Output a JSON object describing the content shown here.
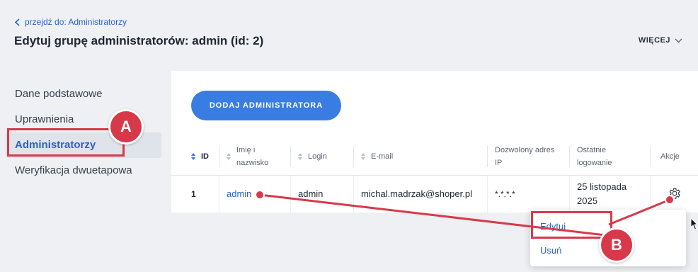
{
  "header": {
    "back_link": "przejdź do: Administratorzy",
    "title": "Edytuj grupę administratorów: admin (id: 2)",
    "more_label": "WIĘCEJ"
  },
  "sidebar": {
    "items": [
      {
        "label": "Dane podstawowe"
      },
      {
        "label": "Uprawnienia"
      },
      {
        "label": "Administratorzy"
      },
      {
        "label": "Weryfikacja dwuetapowa"
      }
    ]
  },
  "main": {
    "add_button": "DODAJ ADMINISTRATORA",
    "columns": {
      "id": "ID",
      "name": "Imię i nazwisko",
      "login": "Login",
      "email": "E-mail",
      "ip": "Dozwolony adres IP",
      "last_login": "Ostatnie logowanie",
      "actions": "Akcje"
    },
    "rows": [
      {
        "id": "1",
        "name": "admin",
        "login": "admin",
        "email": "michal.madrzak@shoper.pl",
        "ip": "*.*.*.*",
        "last_login": "25 listopada 2025"
      }
    ]
  },
  "action_menu": {
    "edit": "Edytuj",
    "delete": "Usuń"
  },
  "annotations": {
    "a": "A",
    "b": "B"
  },
  "colors": {
    "accent": "#3a7de2",
    "link": "#2d62c8",
    "callout": "#d8394a"
  }
}
